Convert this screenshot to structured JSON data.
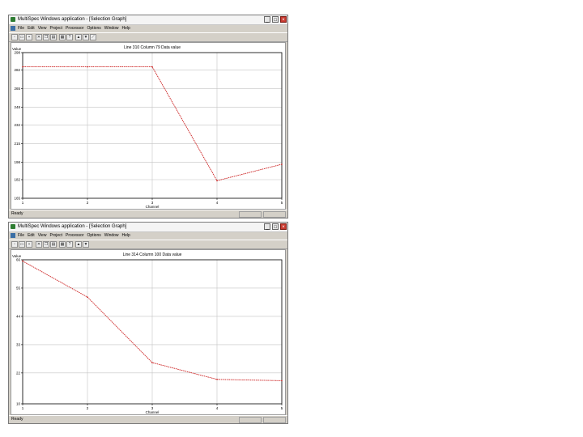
{
  "windows": [
    {
      "title": "MultiSpec Windows application - [Selection Graph]",
      "menu": [
        "File",
        "Edit",
        "View",
        "Project",
        "Processor",
        "Options",
        "Window",
        "Help"
      ],
      "toolbar_icons": [
        "new-icon",
        "open-icon",
        "save-icon",
        "cut-icon",
        "copy-icon",
        "paste-icon",
        "print-icon",
        "help-icon",
        "zoom-in-icon",
        "zoom-out-icon",
        "overlay-icon"
      ],
      "status": "Ready",
      "chart_data": {
        "type": "line",
        "title": "Line 310 Column 79 Data value",
        "xlabel": "Channel",
        "ylabel": "Value",
        "x": [
          1,
          2,
          3,
          4,
          5
        ],
        "xticks": [
          "1",
          "2",
          "3",
          "4",
          "5"
        ],
        "yticks": [
          "165",
          "182",
          "198",
          "215",
          "232",
          "248",
          "265",
          "282",
          "298"
        ],
        "ylim": [
          165,
          298
        ],
        "series": [
          {
            "values": [
              285,
              285,
              285,
              181,
              196
            ],
            "color": "#cc2222"
          }
        ],
        "grid": true
      }
    },
    {
      "title": "MultiSpec Windows application - [Selection Graph]",
      "menu": [
        "File",
        "Edit",
        "View",
        "Project",
        "Processor",
        "Options",
        "Window",
        "Help"
      ],
      "toolbar_icons": [
        "new-icon",
        "open-icon",
        "save-icon",
        "cut-icon",
        "copy-icon",
        "paste-icon",
        "print-icon",
        "help-icon",
        "zoom-in-icon",
        "zoom-out-icon"
      ],
      "status": "Ready",
      "chart_data": {
        "type": "line",
        "title": "Line 314 Column 100 Data value",
        "xlabel": "Channel",
        "ylabel": "Value",
        "x": [
          1,
          2,
          3,
          4,
          5
        ],
        "xticks": [
          "1",
          "2",
          "3",
          "4",
          "5"
        ],
        "yticks": [
          "10",
          "22",
          "33",
          "44",
          "55",
          "66"
        ],
        "ylim": [
          10,
          66
        ],
        "series": [
          {
            "values": [
              65.5,
              51.5,
              26,
              19.5,
              19
            ],
            "color": "#cc2222"
          }
        ],
        "grid": true
      }
    }
  ]
}
